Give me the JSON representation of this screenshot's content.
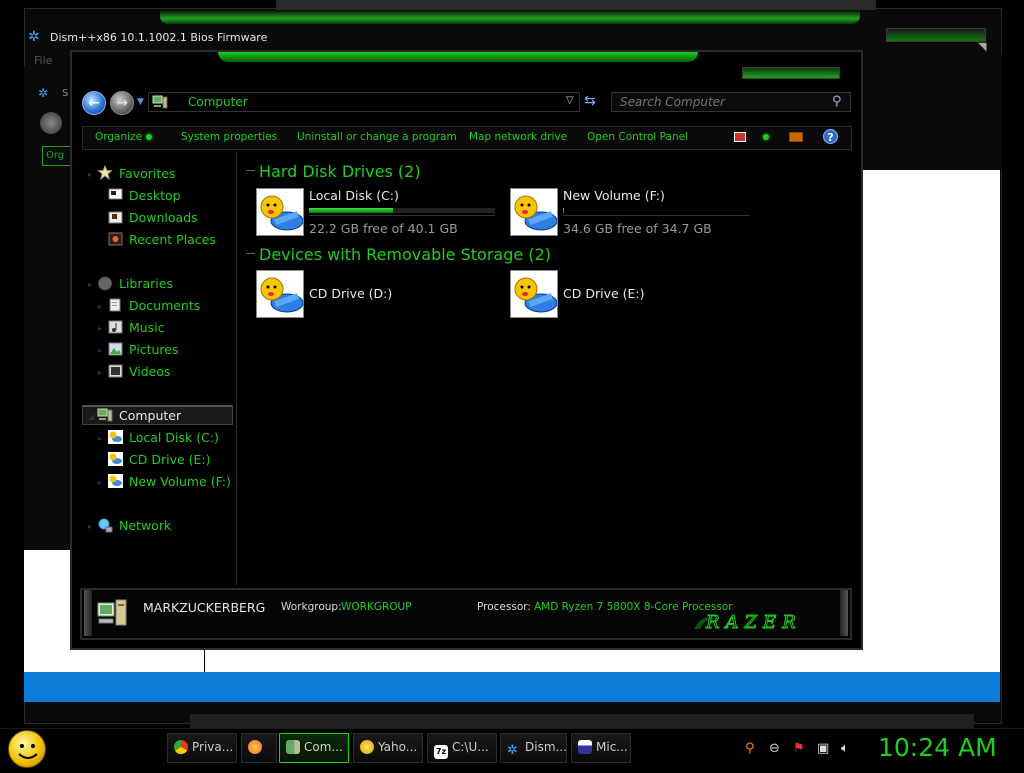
{
  "background_window": {
    "title": "Dism++x86 10.1.1002.1 Bios Firmware",
    "menu_file": "File",
    "inner_s": "S",
    "inner_org": "Org"
  },
  "explorer": {
    "address": "Computer",
    "search_placeholder": "Search Computer",
    "commands": {
      "organize": "Organize",
      "system_properties": "System properties",
      "uninstall": "Uninstall or change a program",
      "map_drive": "Map network drive",
      "control_panel": "Open Control Panel",
      "help": "?"
    },
    "nav": {
      "favorites": "Favorites",
      "desktop": "Desktop",
      "downloads": "Downloads",
      "recent_places": "Recent Places",
      "libraries": "Libraries",
      "documents": "Documents",
      "music": "Music",
      "pictures": "Pictures",
      "videos": "Videos",
      "computer": "Computer",
      "local_disk_c": "Local Disk (C:)",
      "cd_drive_e": "CD Drive (E:)",
      "new_volume_f": "New Volume (F:)",
      "network": "Network"
    },
    "groups": {
      "hard_disks": "Hard Disk Drives (2)",
      "removable": "Devices with Removable Storage (2)"
    },
    "drives": {
      "c": {
        "name": "Local Disk (C:)",
        "free": "22.2 GB free of 40.1 GB",
        "used_fraction": 0.45
      },
      "f": {
        "name": "New Volume (F:)",
        "free": "34.6 GB free of 34.7 GB",
        "used_fraction": 0.003
      },
      "d": {
        "name": "CD Drive (D:)"
      },
      "e": {
        "name": "CD Drive (E:)"
      }
    },
    "details": {
      "computer_name": "MARKZUCKERBERG",
      "workgroup_label": "Workgroup:",
      "workgroup": "WORKGROUP",
      "processor_label": "Processor:",
      "processor": "AMD Ryzen 7 5800X 8-Core Processor",
      "logo_text": "RAZER"
    }
  },
  "taskbar": {
    "items": [
      {
        "label": "Priva...",
        "icon": "chrome-icon"
      },
      {
        "label": "",
        "icon": "firefox-icon"
      },
      {
        "label": "Com...",
        "icon": "computer-icon",
        "active": true
      },
      {
        "label": "Yaho...",
        "icon": "yahoo-messenger-icon"
      },
      {
        "label": "C:\\U...",
        "icon": "7zip-icon"
      },
      {
        "label": "Dism...",
        "icon": "dism-gear-icon"
      },
      {
        "label": "Mic...",
        "icon": "microsoft-icon"
      }
    ],
    "clock": "10:24 AM"
  },
  "colors": {
    "accent_green": "#1fcf1f",
    "background": "#000000",
    "blue_bar": "#0a7bd6"
  }
}
